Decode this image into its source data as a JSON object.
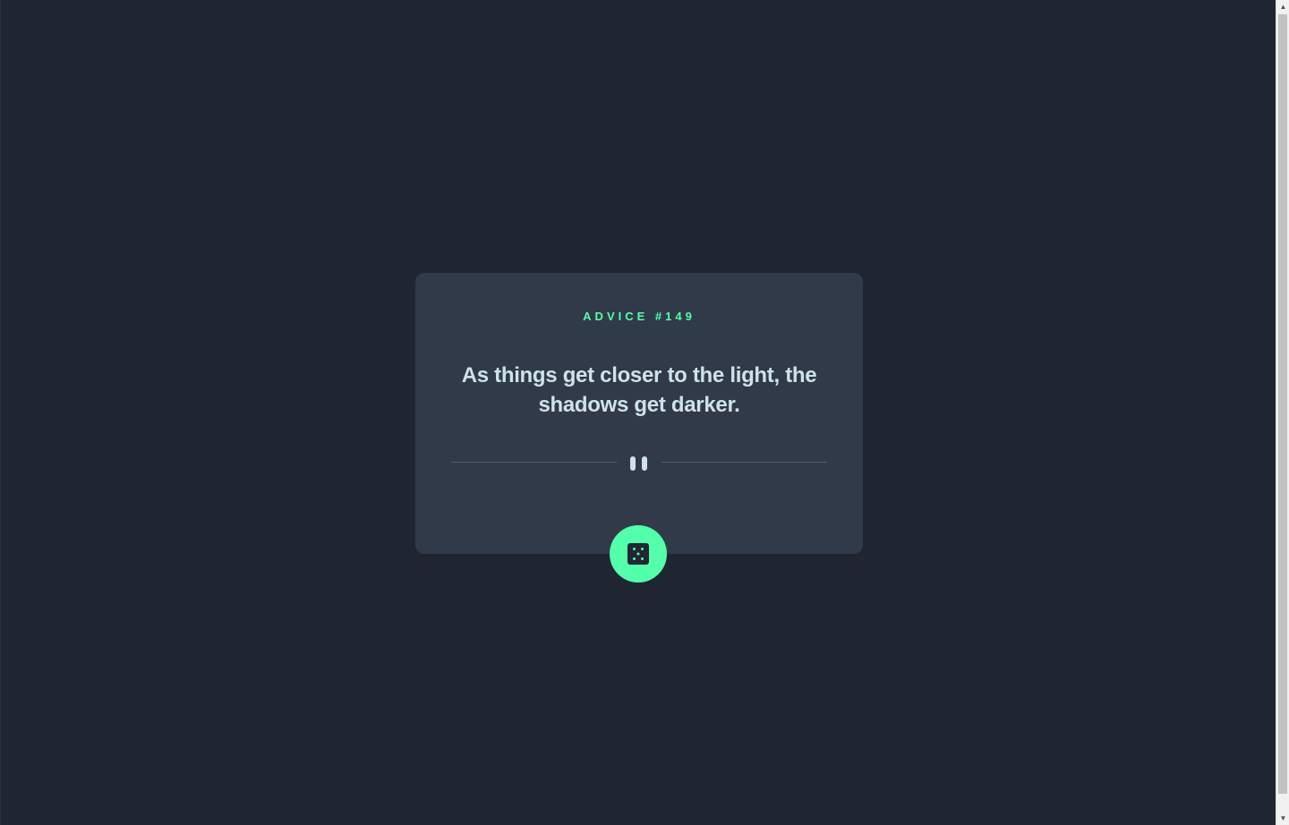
{
  "advice": {
    "label": "ADVICE #149",
    "quote": "As things get closer to the light, the shadows get darker."
  },
  "divider": {
    "icon": "pause-icon"
  },
  "button": {
    "icon": "dice-icon",
    "aria_label": "Generate new advice"
  },
  "colors": {
    "page_background": "#1f2632",
    "card_background": "#313a48",
    "accent": "#53ffaa",
    "quote_text": "#cee3e9",
    "divider_line": "#4f5d74"
  }
}
